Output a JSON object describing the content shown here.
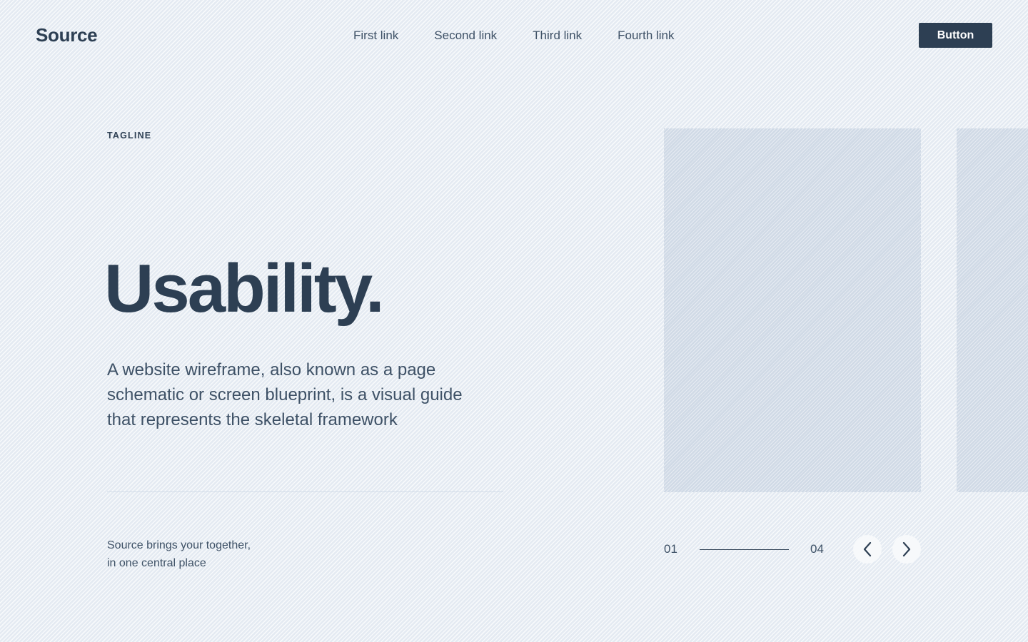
{
  "header": {
    "logo": "Source",
    "nav_links": [
      "First link",
      "Second link",
      "Third link",
      "Fourth link"
    ],
    "button_label": "Button"
  },
  "hero": {
    "tagline": "TAGLINE",
    "title": "Usability.",
    "description": "A website wireframe, also known as a page schematic or screen blueprint, is a visual guide that represents the skeletal framework",
    "footnote_line1": "Source brings your  together,",
    "footnote_line2": "in one central place"
  },
  "slider": {
    "current": "01",
    "total": "04",
    "progress": 1.0,
    "prev_icon": "chevron-left-icon",
    "next_icon": "chevron-right-icon"
  },
  "colors": {
    "primary": "#2d3f53",
    "background": "#edf2f7",
    "placeholder": "#dae2ec"
  }
}
